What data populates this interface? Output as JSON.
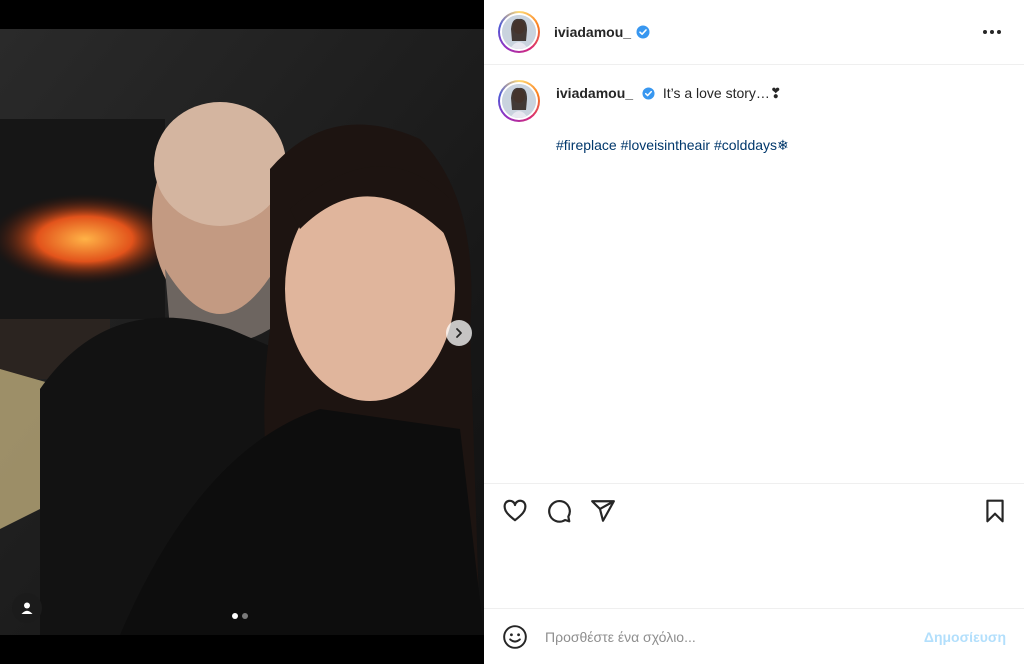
{
  "post": {
    "username": "iviadamou_",
    "caption": "It’s a love story…❣",
    "hashtags": [
      "#fireplace",
      "#loveisintheair",
      "#colddays❄"
    ]
  },
  "comment": {
    "placeholder": "Προσθέστε ένα σχόλιο...",
    "post_label": "Δημοσίευση"
  },
  "carousel": {
    "current": 1,
    "total": 2
  },
  "icons": {
    "header": [
      "verified-badge-icon",
      "more-options-icon"
    ],
    "actions": [
      "heart-icon",
      "comment-icon",
      "share-icon",
      "bookmark-icon"
    ],
    "media": [
      "chevron-right-icon",
      "user-tag-icon"
    ],
    "comment": [
      "emoji-icon"
    ]
  },
  "colors": {
    "verified": "#3897f0",
    "hashtag": "#00376b",
    "post_button_disabled": "#b2dffc",
    "divider": "#efefef"
  }
}
